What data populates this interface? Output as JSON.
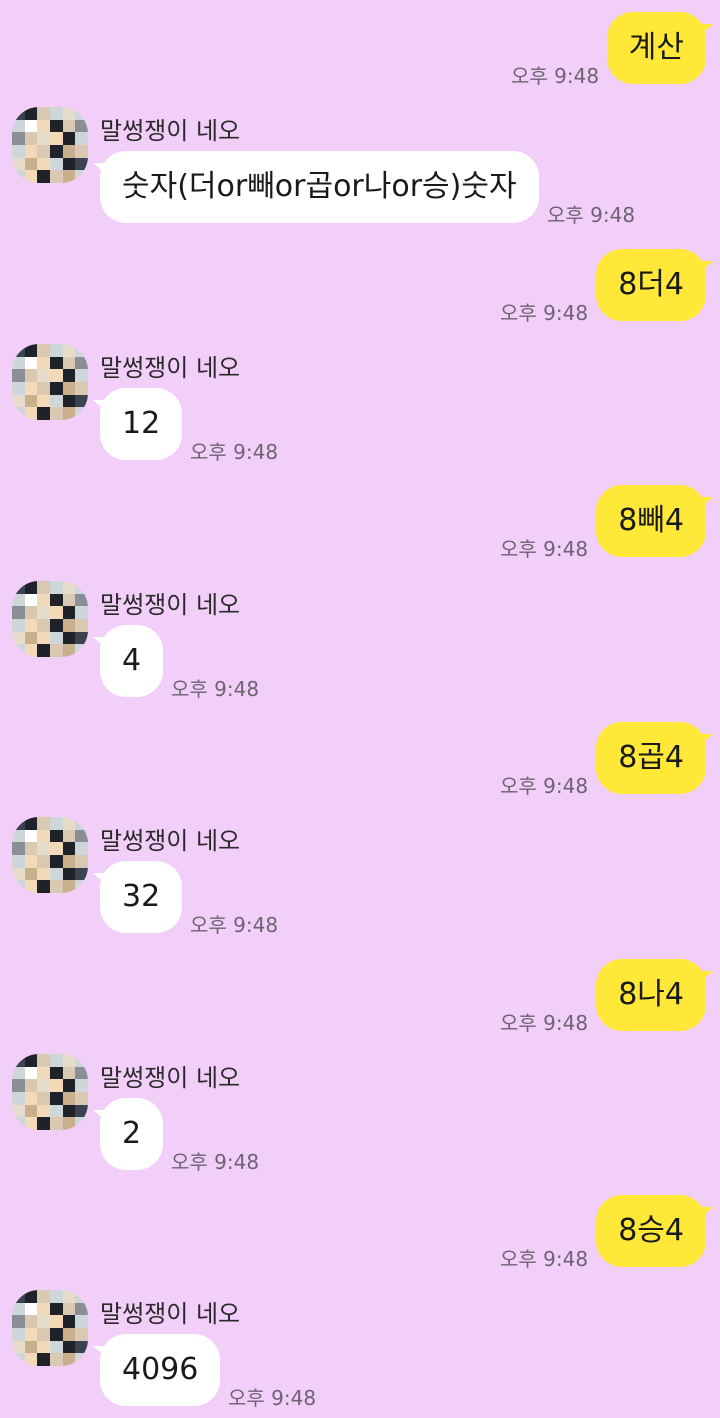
{
  "contact": {
    "name": "말썽쟁이 네오"
  },
  "messages": [
    {
      "from": "me",
      "text": "계산",
      "time": "오후 9:48"
    },
    {
      "from": "them",
      "text": "숫자(더or빼or곱or나or승)숫자",
      "time": "오후 9:48"
    },
    {
      "from": "me",
      "text": "8더4",
      "time": "오후 9:48"
    },
    {
      "from": "them",
      "text": "12",
      "time": "오후 9:48"
    },
    {
      "from": "me",
      "text": "8빼4",
      "time": "오후 9:48"
    },
    {
      "from": "them",
      "text": "4",
      "time": "오후 9:48"
    },
    {
      "from": "me",
      "text": "8곱4",
      "time": "오후 9:48"
    },
    {
      "from": "them",
      "text": "32",
      "time": "오후 9:48"
    },
    {
      "from": "me",
      "text": "8나4",
      "time": "오후 9:48"
    },
    {
      "from": "them",
      "text": "2",
      "time": "오후 9:48"
    },
    {
      "from": "me",
      "text": "8승4",
      "time": "오후 9:48"
    },
    {
      "from": "them",
      "text": "4096",
      "time": "오후 9:48"
    }
  ],
  "colors": {
    "background": "#f2cff8",
    "my_bubble": "#ffe838",
    "their_bubble": "#ffffff",
    "time_text": "#6c6470"
  },
  "icons": {
    "avatar": "pixelated-avatar-icon"
  }
}
